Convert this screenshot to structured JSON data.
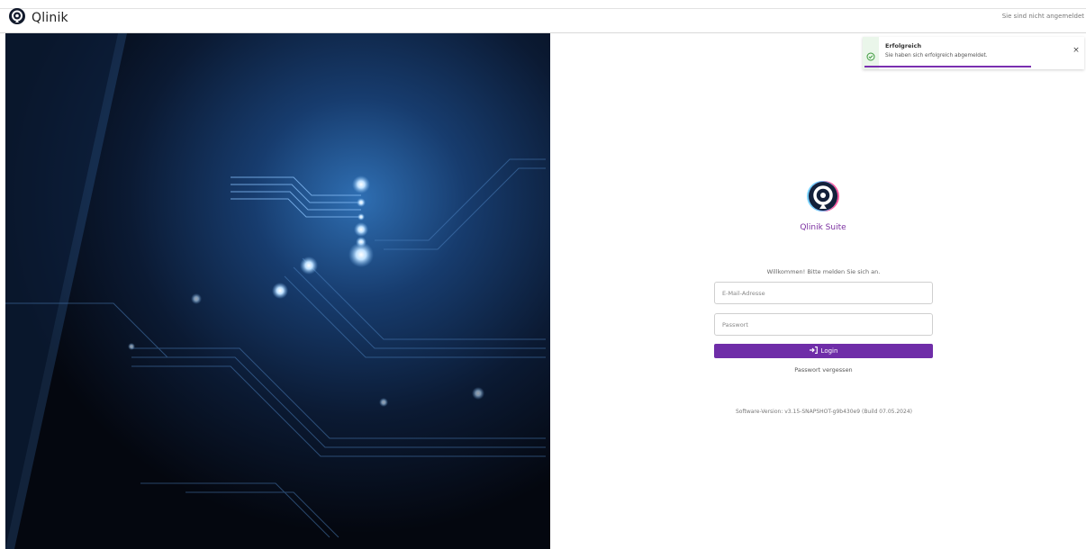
{
  "header": {
    "brand_name": "Qlinik",
    "auth_status": "Sie sind nicht angemeldet"
  },
  "login": {
    "suite_name": "Qlinik Suite",
    "welcome": "Willkommen! Bitte melden Sie sich an.",
    "email_placeholder": "E-Mail-Adresse",
    "email_value": "",
    "password_placeholder": "Passwort",
    "password_value": "",
    "login_label": "Login",
    "forgot_label": "Passwort vergessen",
    "version": "Software-Version: v3.15-SNAPSHOT-g9b430e9 (Build 07.05.2024)"
  },
  "toast": {
    "title": "Erfolgreich",
    "message": "Sie haben sich erfolgreich abgemeldet.",
    "close_label": "×",
    "progress": 0.75
  },
  "icons": {
    "brand": "location-pin-icon",
    "login": "sign-in-icon",
    "toast": "check-circle-icon",
    "close": "close-icon"
  },
  "colors": {
    "accent": "#6f2da8",
    "success": "#3c9a3c",
    "hero_dark": "#050b18"
  }
}
